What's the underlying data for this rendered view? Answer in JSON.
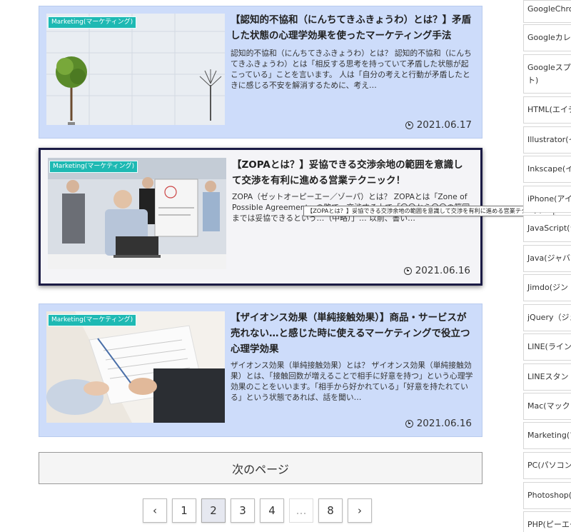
{
  "posts": [
    {
      "category": "Marketing(マーケティング)",
      "title": "【認知的不協和（にんちてきふきょうわ）とは？】矛盾した状態の心理学効果を使ったマーケティング手法",
      "excerpt": "認知的不協和（にんちてきふきょうわ）とは？ 認知的不協和（にんちてきふきょうわ）とは「相反する思考を持っていて矛盾した状態が起こっている」ことを言います。 人は「自分の考えと行動が矛盾したときに感じる不安を解消するために、考え…",
      "date": "2021.06.17"
    },
    {
      "category": "Marketing(マーケティング)",
      "title": "【ZOPAとは？】妥協できる交渉余地の範囲を意識して交渉を有利に進める営業テクニック！",
      "excerpt": "ZOPA（ゼットオーピーエー／ゾーパ）とは？ ZOPAとは「Zone of Possible Agreement」の略で、交渉する上で「〇〇から〇〇の範囲までは妥協できるという…（中略）」… 以前、書い…",
      "date": "2021.06.16"
    },
    {
      "category": "Marketing(マーケティング)",
      "title": "【ザイオンス効果（単純接触効果）】商品・サービスが売れない…と感じた時に使えるマーケティングで役立つ心理学効果",
      "excerpt": "ザイオンス効果（単純接触効果）とは？ ザイオンス効果（単純接触効果）とは、「接触回数が増えることで相手に好意を持つ」という心理学効果のことをいいます。「相手から好かれている」「好意を持たれている」という状態であれば、話を聞い…",
      "date": "2021.06.16"
    }
  ],
  "tooltip": "【ZOPAとは？】妥協できる交渉余地の範囲を意識して交渉を有利に進める営業テクニック！",
  "next_page_label": "次のページ",
  "pagination": {
    "prev": "‹",
    "next": "›",
    "pages": [
      "1",
      "2",
      "3",
      "4",
      "…",
      "8"
    ],
    "current": "2"
  },
  "sidebar": {
    "items": [
      "GoogleChro",
      "Googleカレ",
      "Googleスプレ",
      "ト)",
      "HTML(エイチ",
      "Illustrator(イ",
      "Inkscape(イ",
      "iPhone(アイ",
      "JavaScript(ジ",
      "Java(ジャバ",
      "Jimdo(ジン",
      "jQuery（ジェ",
      "LINE(ライン",
      "LINEスタン",
      "Mac(マック",
      "Marketing(マ",
      "PC(パソコン",
      "Photoshop(フ",
      "PHP(ピーエー"
    ]
  },
  "colors": {
    "card_bg": "#cddcfa",
    "hover_card_bg": "#f4f4f7",
    "badge_bg": "#1eb9b3"
  }
}
